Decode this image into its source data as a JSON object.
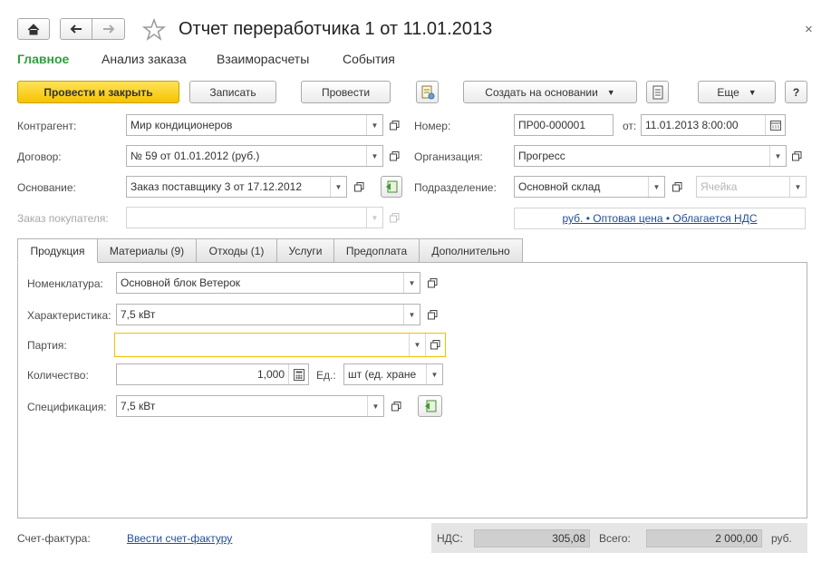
{
  "window": {
    "title": "Отчет переработчика 1 от 11.01.2013",
    "close_label": "×"
  },
  "sections": [
    {
      "label": "Главное"
    },
    {
      "label": "Анализ заказа"
    },
    {
      "label": "Взаиморасчеты"
    },
    {
      "label": "События"
    }
  ],
  "toolbar": {
    "post_close": "Провести и закрыть",
    "save": "Записать",
    "post": "Провести",
    "create_based": "Создать на основании",
    "more": "Еще",
    "help": "?"
  },
  "header": {
    "contractor_label": "Контрагент:",
    "contractor_value": "Мир кондиционеров",
    "contract_label": "Договор:",
    "contract_value": "№ 59 от 01.01.2012 (руб.)",
    "basis_label": "Основание:",
    "basis_value": "Заказ поставщику 3 от 17.12.2012",
    "customer_order_label": "Заказ покупателя:",
    "customer_order_value": "",
    "number_label": "Номер:",
    "number_value": "ПР00-000001",
    "date_label": "от:",
    "date_value": "11.01.2013  8:00:00",
    "organization_label": "Организация:",
    "organization_value": "Прогресс",
    "department_label": "Подразделение:",
    "department_value": "Основной склад",
    "cell_placeholder": "Ячейка",
    "price_info": "руб. • Оптовая цена • Облагается НДС"
  },
  "tabs": [
    {
      "label": "Продукция",
      "active": true
    },
    {
      "label": "Материалы (9)"
    },
    {
      "label": "Отходы (1)"
    },
    {
      "label": "Услуги"
    },
    {
      "label": "Предоплата"
    },
    {
      "label": "Дополнительно"
    }
  ],
  "product": {
    "nomenclature_label": "Номенклатура:",
    "nomenclature_value": "Основной блок Ветерок",
    "characteristic_label": "Характеристика:",
    "characteristic_value": "7,5 кВт",
    "batch_label": "Партия:",
    "batch_value": "",
    "quantity_label": "Количество:",
    "quantity_value": "1,000",
    "unit_label": "Ед.:",
    "unit_value": "шт (ед. хране",
    "specification_label": "Спецификация:",
    "specification_value": "7,5 кВт"
  },
  "footer": {
    "invoice_label": "Счет-фактура:",
    "invoice_link": "Ввести счет-фактуру",
    "vat_label": "НДС:",
    "vat_value": "305,08",
    "total_label": "Всего:",
    "total_value": "2 000,00",
    "currency": "руб."
  },
  "colors": {
    "accent_green": "#2e9f3c",
    "primary_yellow": "#f5c400",
    "link_blue": "#1f4f9b",
    "focus_border": "#f2c000"
  }
}
